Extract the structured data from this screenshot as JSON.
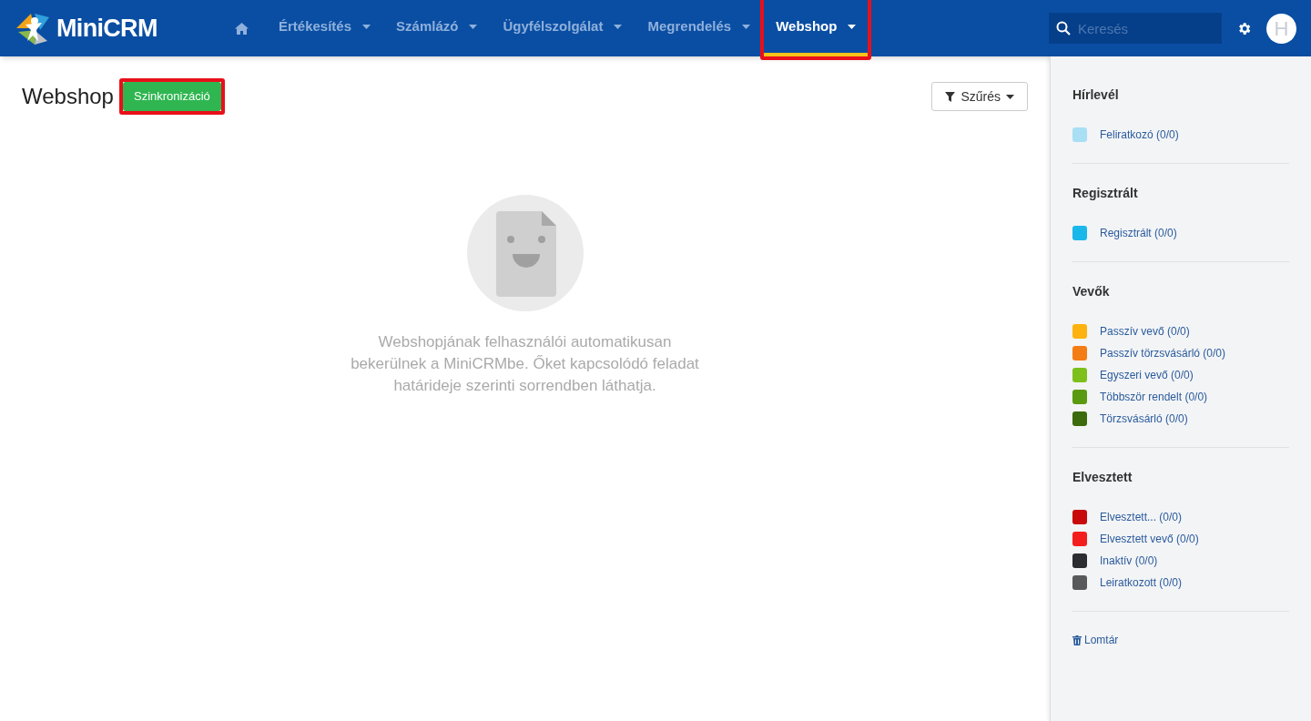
{
  "header": {
    "logo": "MiniCRM",
    "nav": [
      {
        "label": "Értékesítés",
        "selected": false,
        "highlighted": false
      },
      {
        "label": "Számlázó",
        "selected": false,
        "highlighted": false
      },
      {
        "label": "Ügyfélszolgálat",
        "selected": false,
        "highlighted": false
      },
      {
        "label": "Megrendelés",
        "selected": false,
        "highlighted": false
      },
      {
        "label": "Webshop",
        "selected": true,
        "highlighted": true
      }
    ],
    "search": {
      "placeholder": "Keresés"
    },
    "avatar": "H"
  },
  "page": {
    "title": "Webshop",
    "sync_button": {
      "label": "Szinkronizáció",
      "highlighted": true
    },
    "filter_button": "Szűrés",
    "empty_message": "Webshopjának felhasználói automatikusan bekerülnek a MiniCRMbe. Őket kapcsolódó feladat határideje szerinti sorrendben láthatja."
  },
  "sidebar": {
    "groups": [
      {
        "title": "Hírlevél",
        "items": [
          {
            "label": "Feliratkozó (0/0)",
            "color": "#a8dff5"
          }
        ]
      },
      {
        "title": "Regisztrált",
        "items": [
          {
            "label": "Regisztrált (0/0)",
            "color": "#1ab7ea"
          }
        ]
      },
      {
        "title": "Vevők",
        "items": [
          {
            "label": "Passzív vevő (0/0)",
            "color": "#fdb20f"
          },
          {
            "label": "Passzív törzsvásárló (0/0)",
            "color": "#f47c14"
          },
          {
            "label": "Egyszeri vevő (0/0)",
            "color": "#7dc01c"
          },
          {
            "label": "Többször rendelt (0/0)",
            "color": "#5a9a10"
          },
          {
            "label": "Törzsvásárló (0/0)",
            "color": "#3b6b0c"
          }
        ]
      },
      {
        "title": "Elvesztett",
        "items": [
          {
            "label": "Elvesztett... (0/0)",
            "color": "#c80a0a"
          },
          {
            "label": "Elvesztett vevő (0/0)",
            "color": "#f51e1e"
          },
          {
            "label": "Inaktív (0/0)",
            "color": "#2c2d30"
          },
          {
            "label": "Leiratkozott (0/0)",
            "color": "#58595b"
          }
        ]
      }
    ],
    "trash": "Lomtár"
  }
}
